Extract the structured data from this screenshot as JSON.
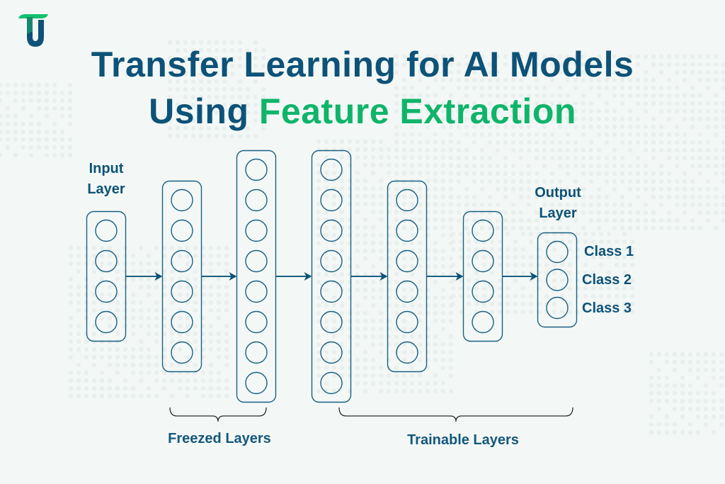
{
  "title": {
    "line1": "Transfer Learning for AI Models",
    "line2_prefix": "Using ",
    "line2_accent": "Feature Extraction"
  },
  "colors": {
    "primary": "#0d5278",
    "accent": "#0fb46a",
    "stroke": "#1b5f82",
    "background": "#f3f8f6",
    "bracket": "#2b2b2b"
  },
  "logo": {
    "icon": "tu-brand-logo-icon"
  },
  "diagram": {
    "layers": [
      {
        "id": "input",
        "nodes": 4,
        "label": "Input Layer",
        "label_lines": [
          "Input",
          "Layer"
        ]
      },
      {
        "id": "hidden-1",
        "nodes": 6
      },
      {
        "id": "hidden-2",
        "nodes": 8
      },
      {
        "id": "hidden-3",
        "nodes": 8
      },
      {
        "id": "hidden-4",
        "nodes": 6
      },
      {
        "id": "hidden-5",
        "nodes": 4
      },
      {
        "id": "output",
        "nodes": 3,
        "label": "Output Layer",
        "label_lines": [
          "Output",
          "Layer"
        ]
      }
    ],
    "classes": [
      "Class 1",
      "Class 2",
      "Class 3"
    ],
    "groups": [
      {
        "label": "Freezed Layers",
        "span_layers": [
          1,
          2
        ]
      },
      {
        "label": "Trainable Layers",
        "span_layers": [
          3,
          6
        ]
      }
    ]
  }
}
